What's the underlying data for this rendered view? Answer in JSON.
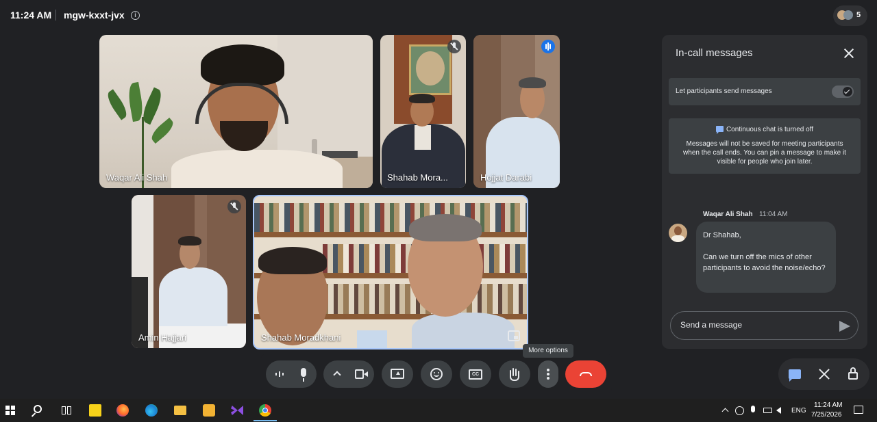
{
  "topbar": {
    "time": "11:24 AM",
    "meeting_code": "mgw-kxxt-jvx",
    "info_icon": "info-icon",
    "participant_count": "5"
  },
  "tiles": [
    {
      "name": "Waqar Ali Shah",
      "status": "speaking-none"
    },
    {
      "name": "Shahab Mora...",
      "status": "muted"
    },
    {
      "name": "Hojjat Darabi",
      "status": "speaking"
    },
    {
      "name": "Amin Hajjari",
      "status": "muted"
    },
    {
      "name": "Shahab Moradkhani",
      "status": "pinned"
    }
  ],
  "panel": {
    "title": "In-call messages",
    "toggle_label": "Let participants send messages",
    "toggle_on": true,
    "notice_title": "Continuous chat is turned off",
    "notice_body": "Messages will not be saved for meeting participants when the call ends. You can pin a message to make it visible for people who join later.",
    "message": {
      "sender": "Waqar Ali Shah",
      "time": "11:04 AM",
      "line1": "Dr Shahab,",
      "line2": "Can we turn off the mics of other participants to avoid the noise/echo?"
    },
    "input_placeholder": "Send a message"
  },
  "controls": {
    "tooltip": "More options",
    "buttons": [
      "audio-settings",
      "mic",
      "more-video",
      "camera",
      "present-screen",
      "emoji-reactions",
      "captions",
      "raise-hand",
      "more-options",
      "end-call"
    ],
    "right": [
      "chat",
      "activities",
      "host-controls"
    ]
  },
  "taskbar": {
    "time": "11:24 AM",
    "date": "7/25/2026",
    "language": "ENG"
  },
  "colors": {
    "background": "#202124",
    "panel": "#2c2d30",
    "end_call": "#ea4335",
    "accent_blue": "#8ab4f8"
  }
}
